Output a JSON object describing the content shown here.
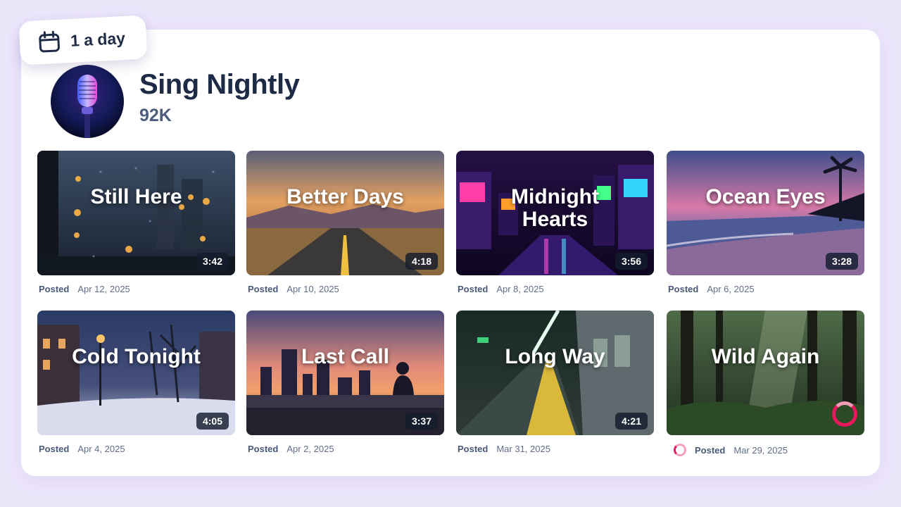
{
  "badge": {
    "label": "1 a day",
    "icon": "calendar-icon"
  },
  "channel": {
    "name": "Sing Nightly",
    "subscribers": "92K",
    "avatar_icon": "microphone-icon"
  },
  "videos": [
    {
      "title": "Still Here",
      "duration": "3:42",
      "posted_label": "Posted",
      "date": "Apr 12, 2025",
      "scene": "rainy-window"
    },
    {
      "title": "Better Days",
      "duration": "4:18",
      "posted_label": "Posted",
      "date": "Apr 10, 2025",
      "scene": "desert-road-sunset"
    },
    {
      "title": "Midnight Hearts",
      "duration": "3:56",
      "posted_label": "Posted",
      "date": "Apr 8, 2025",
      "scene": "neon-arcade"
    },
    {
      "title": "Ocean Eyes",
      "duration": "3:28",
      "posted_label": "Posted",
      "date": "Apr 6, 2025",
      "scene": "beach-dusk"
    },
    {
      "title": "Cold Tonight",
      "duration": "4:05",
      "posted_label": "Posted",
      "date": "Apr 4, 2025",
      "scene": "snowy-street"
    },
    {
      "title": "Last Call",
      "duration": "3:37",
      "posted_label": "Posted",
      "date": "Apr 2, 2025",
      "scene": "city-rooftop-sunset"
    },
    {
      "title": "Long Way",
      "duration": "4:21",
      "posted_label": "Posted",
      "date": "Mar 31, 2025",
      "scene": "subway-platform"
    },
    {
      "title": "Wild Again",
      "duration": "",
      "posted_label": "Posted",
      "date": "Mar 29, 2025",
      "scene": "forest",
      "status": "processing"
    }
  ],
  "colors": {
    "background": "#ece6fb",
    "title": "#1e2b47",
    "accent_loading": "#e8185e"
  }
}
